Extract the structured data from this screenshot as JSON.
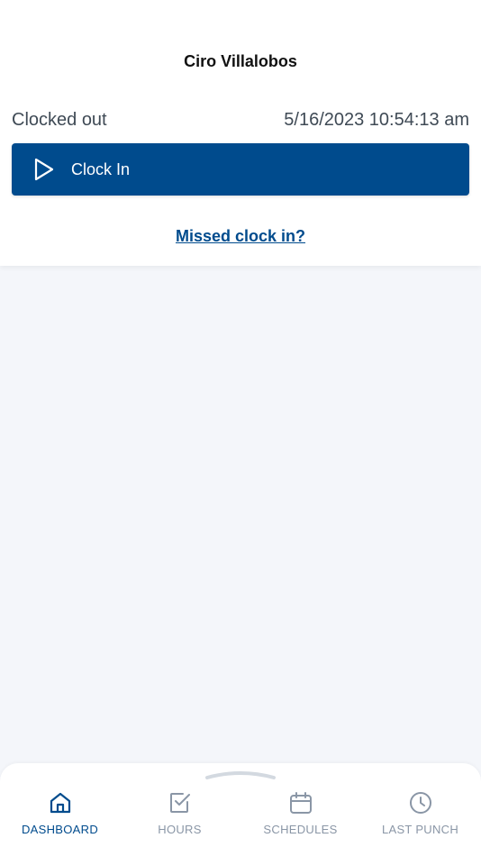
{
  "header": {
    "user_name": "Ciro Villalobos"
  },
  "status": {
    "state": "Clocked out",
    "datetime": "5/16/2023 10:54:13 am"
  },
  "actions": {
    "clock_in_label": "Clock In",
    "missed_clock_in": "Missed clock in?"
  },
  "nav": {
    "items": [
      {
        "label": "DASHBOARD",
        "icon": "home-icon",
        "active": true
      },
      {
        "label": "HOURS",
        "icon": "checkbox-icon",
        "active": false
      },
      {
        "label": "SCHEDULES",
        "icon": "calendar-icon",
        "active": false
      },
      {
        "label": "LAST PUNCH",
        "icon": "clock-icon",
        "active": false
      }
    ]
  },
  "colors": {
    "primary": "#004b8d",
    "inactive": "#8a96a6",
    "background": "#f4f6fa"
  }
}
